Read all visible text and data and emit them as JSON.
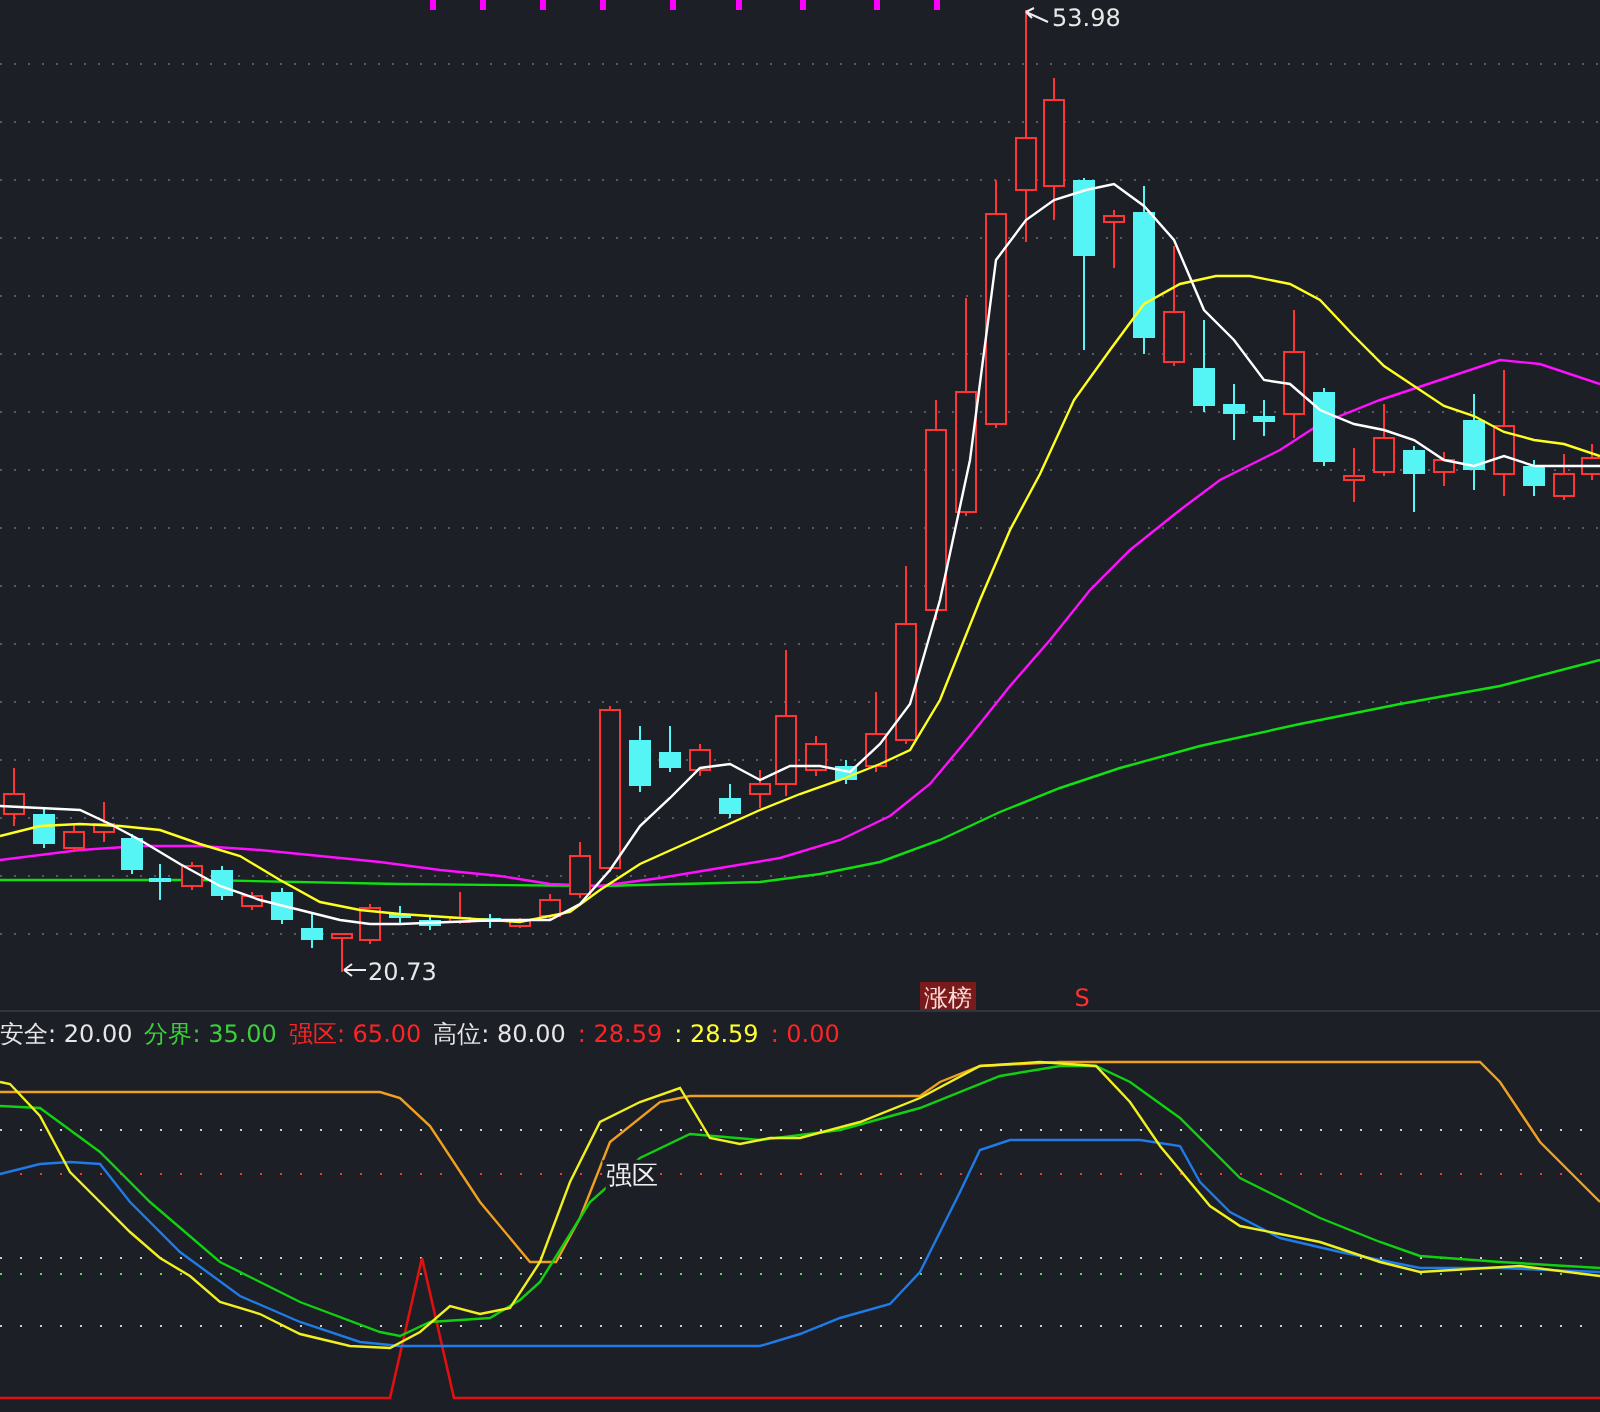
{
  "price_chart": {
    "high_label": "53.98",
    "low_label": "20.73",
    "signals": [
      {
        "text": "涨榜",
        "kind": "tag"
      },
      {
        "text": "S",
        "kind": "mark"
      }
    ]
  },
  "indicator_legend": [
    {
      "text": "安全: 20.00",
      "color": "#e6e6e6"
    },
    {
      "text": "分界: 35.00",
      "color": "#3ad13a"
    },
    {
      "text": "强区: 65.00",
      "color": "#ff2424"
    },
    {
      "text": "高位: 80.00",
      "color": "#e6e6e6"
    },
    {
      "text": ": 28.59",
      "color": "#ff2424"
    },
    {
      "text": ": 28.59",
      "color": "#ffff33"
    },
    {
      "text": ": 0.00",
      "color": "#ff2424"
    }
  ],
  "indicator_chart": {
    "zone_label": "强区"
  }
}
